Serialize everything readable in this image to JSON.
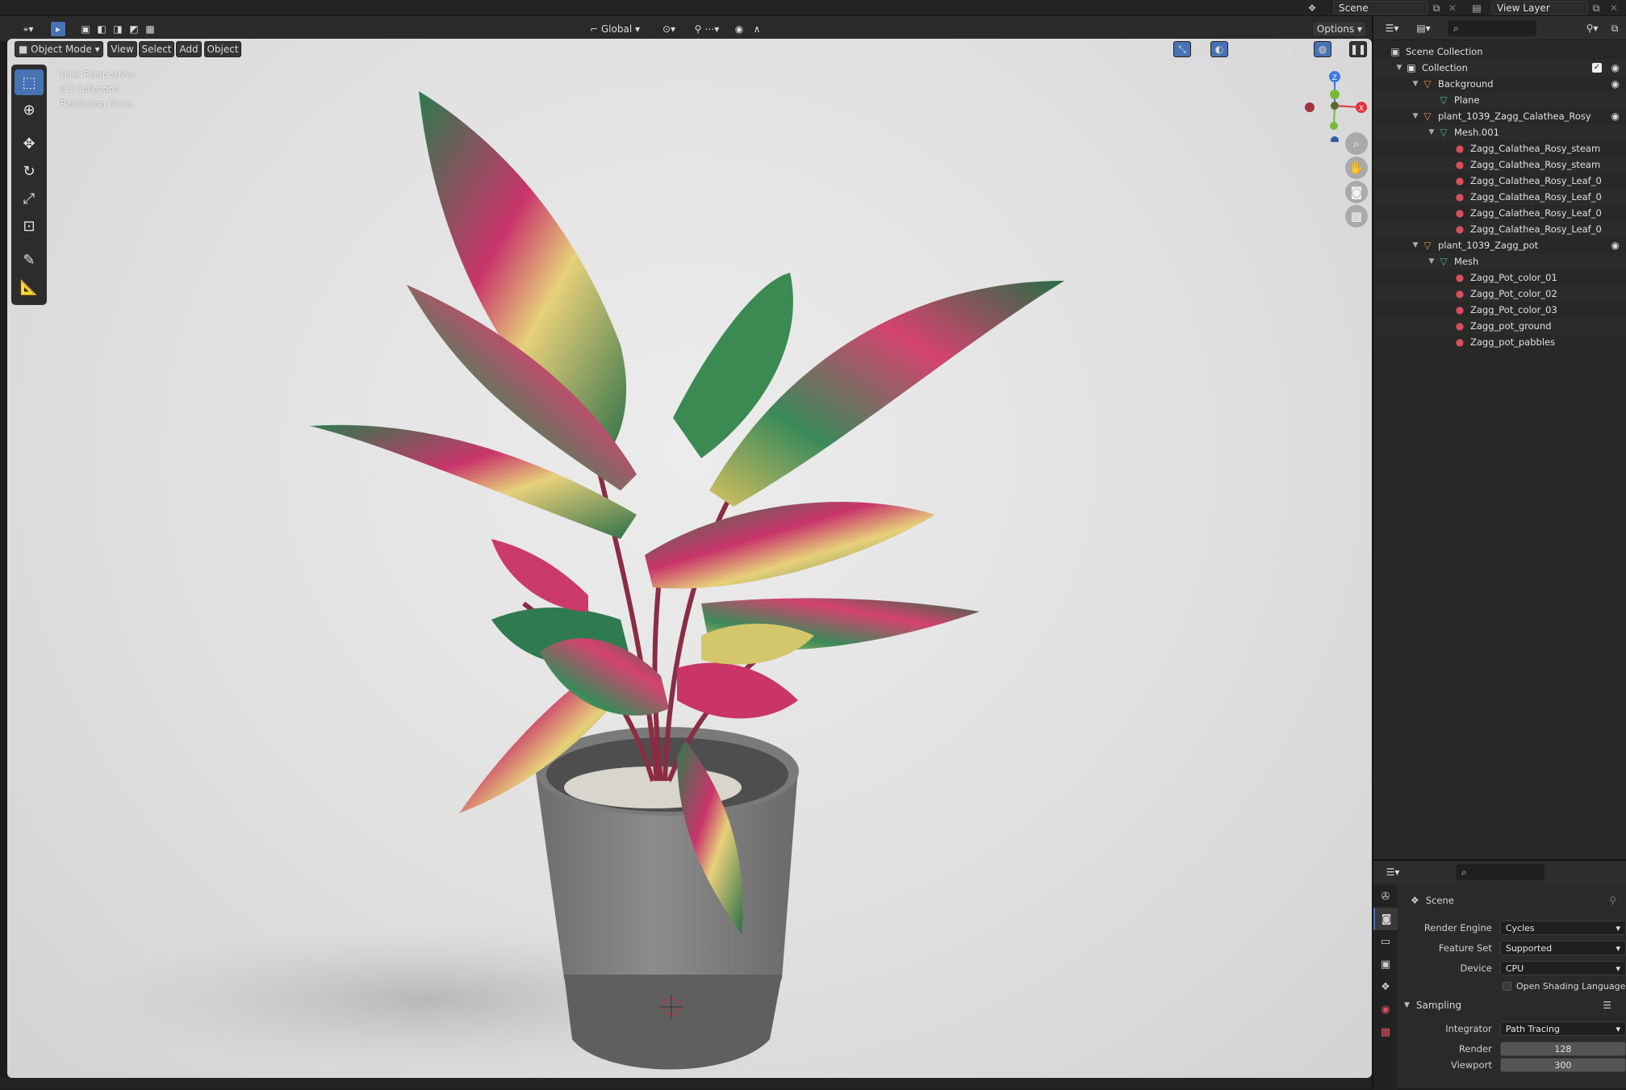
{
  "topbar": {
    "scene_label": "Scene",
    "view_layer_label": "View Layer"
  },
  "viewport_header": {
    "mode": "Object Mode",
    "menus": [
      "View",
      "Select",
      "Add",
      "Object"
    ],
    "orientation": "Global",
    "options_label": "Options"
  },
  "viewport": {
    "info": [
      "User Perspective",
      "(1) Collection",
      "Rendering Done"
    ],
    "axis_labels": {
      "x": "X",
      "y": "Y",
      "z": "Z"
    }
  },
  "toolbar": {
    "tools": [
      "select-box",
      "cursor",
      "move",
      "rotate",
      "scale",
      "transform",
      "annotate",
      "measure"
    ],
    "active": "select-box"
  },
  "outliner": {
    "root": "Scene Collection",
    "rows": [
      {
        "label": "Collection",
        "icon": "collection",
        "depth": 0,
        "expanded": true,
        "checkbox": true,
        "eye": true
      },
      {
        "label": "Background",
        "icon": "object",
        "depth": 1,
        "expanded": true,
        "eye": true
      },
      {
        "label": "Plane",
        "icon": "mesh",
        "depth": 2,
        "expanded": null
      },
      {
        "label": "plant_1039_Zagg_Calathea_Rosy",
        "icon": "object",
        "depth": 1,
        "expanded": true,
        "eye": true
      },
      {
        "label": "Mesh.001",
        "icon": "mesh",
        "depth": 2,
        "expanded": true
      },
      {
        "label": "Zagg_Calathea_Rosy_steam",
        "icon": "material",
        "depth": 3
      },
      {
        "label": "Zagg_Calathea_Rosy_steam",
        "icon": "material",
        "depth": 3
      },
      {
        "label": "Zagg_Calathea_Rosy_Leaf_0",
        "icon": "material",
        "depth": 3
      },
      {
        "label": "Zagg_Calathea_Rosy_Leaf_0",
        "icon": "material",
        "depth": 3
      },
      {
        "label": "Zagg_Calathea_Rosy_Leaf_0",
        "icon": "material",
        "depth": 3
      },
      {
        "label": "Zagg_Calathea_Rosy_Leaf_0",
        "icon": "material",
        "depth": 3
      },
      {
        "label": "plant_1039_Zagg_pot",
        "icon": "object",
        "depth": 1,
        "expanded": true,
        "eye": true
      },
      {
        "label": "Mesh",
        "icon": "mesh",
        "depth": 2,
        "expanded": true
      },
      {
        "label": "Zagg_Pot_color_01",
        "icon": "material",
        "depth": 3
      },
      {
        "label": "Zagg_Pot_color_02",
        "icon": "material",
        "depth": 3
      },
      {
        "label": "Zagg_Pot_color_03",
        "icon": "material",
        "depth": 3
      },
      {
        "label": "Zagg_pot_ground",
        "icon": "material",
        "depth": 3
      },
      {
        "label": "Zagg_pot_pabbles",
        "icon": "material",
        "depth": 3
      }
    ]
  },
  "properties": {
    "context": "Scene",
    "render_engine_label": "Render Engine",
    "render_engine": "Cycles",
    "feature_set_label": "Feature Set",
    "feature_set": "Supported",
    "device_label": "Device",
    "device": "CPU",
    "osl_label": "Open Shading Language",
    "sampling_label": "Sampling",
    "integrator_label": "Integrator",
    "integrator": "Path Tracing",
    "render_label": "Render",
    "render_samples": "128",
    "viewport_label": "Viewport",
    "viewport_samples": "300"
  },
  "colors": {
    "accent": "#4772b3",
    "axis_x": "#e0333f",
    "axis_y": "#7ab83a",
    "axis_z": "#3b7be0",
    "object_icon": "#e0914a",
    "mesh_icon": "#3fbf8f",
    "material_icon": "#d8505a"
  }
}
